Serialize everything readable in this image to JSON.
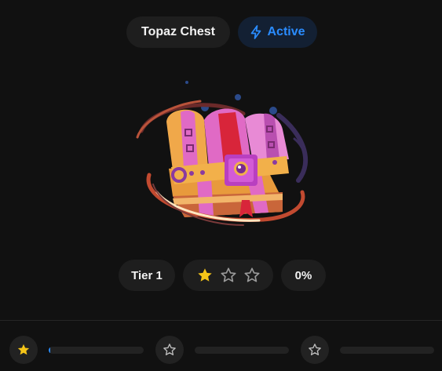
{
  "header": {
    "title": "Topaz Chest",
    "status_label": "Active",
    "status_icon": "lightning-bolt-icon"
  },
  "chest": {
    "image_icon": "treasure-chest-illustration"
  },
  "info": {
    "tier_label": "Tier 1",
    "stars_total": 3,
    "stars_filled": 1,
    "progress_text": "0%"
  },
  "progress_steps": [
    {
      "icon": "star-filled-icon",
      "reached": true,
      "progress": 0.02
    },
    {
      "icon": "star-outline-icon",
      "reached": false,
      "progress": 0
    },
    {
      "icon": "star-outline-icon",
      "reached": false,
      "progress": 0
    }
  ],
  "colors": {
    "background": "#111111",
    "pill_background": "#1e1e1e",
    "accent_blue": "#2a8cff",
    "active_background": "#132033",
    "star_gold": "#f5c518",
    "star_outline": "#9a9a9a"
  }
}
